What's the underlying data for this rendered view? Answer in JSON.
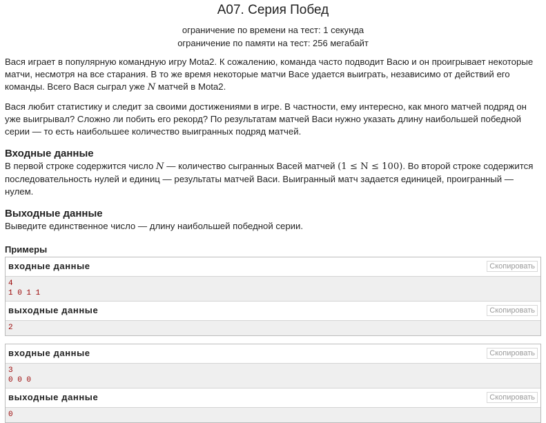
{
  "problem": {
    "title": "A07. Серия Побед",
    "time_limit": "ограничение по времени на тест: 1 секунда",
    "memory_limit": "ограничение по памяти на тест: 256 мегабайт"
  },
  "statement": {
    "p1_a": "Вася играет в популярную командную игру Mota2. К сожалению, команда часто подводит Васю и он проигрывает некоторые матчи, несмотря на все старания. В то же время некоторые матчи Васе удается выиграть, независимо от действий его команды. Всего Вася сыграл уже ",
    "p1_var": "N",
    "p1_b": " матчей в Mota2.",
    "p2": "Вася любит статистику и следит за своими достижениями в игре. В частности, ему интересно, как много матчей подряд он уже выигрывал? Сложно ли побить его рекорд? По результатам матчей Васи нужно указать длину наибольшей победной серии — то есть наибольшее количество выигранных подряд матчей."
  },
  "input_spec": {
    "title": "Входные данные",
    "text_a": "В первой строке содержится число ",
    "var": "N",
    "text_b": " — количество сыгранных Васей матчей ",
    "constraint": "(1 ≤ N ≤ 100)",
    "text_c": ". Во второй строке содержится последовательность нулей и единиц — результаты матчей Васи. Выигранный матч задается единицей, проигранный — нулем."
  },
  "output_spec": {
    "title": "Выходные данные",
    "text": "Выведите единственное число — длину наибольшей победной серии."
  },
  "examples": {
    "title": "Примеры",
    "input_label": "входные данные",
    "output_label": "выходные данные",
    "copy_label": "Скопировать",
    "tests": [
      {
        "input": "4\n1 0 1 1",
        "output": "2"
      },
      {
        "input": "3\n0 0 0",
        "output": "0"
      }
    ]
  }
}
